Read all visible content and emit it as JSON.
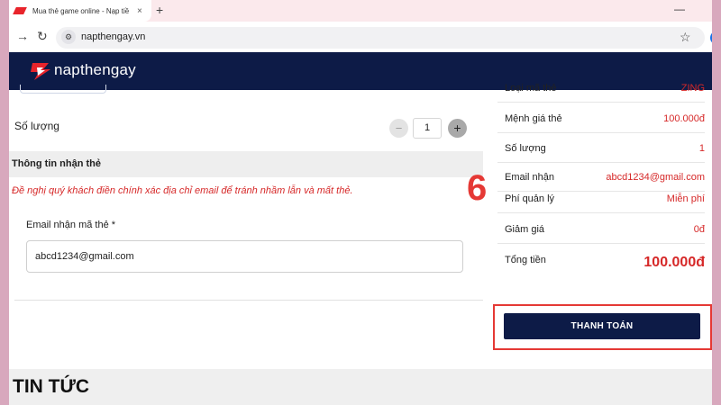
{
  "browser": {
    "tab_title": "Mua thẻ game online - Nạp tiề",
    "tab_close": "×",
    "new_tab": "+",
    "minimize": "—",
    "back": "→",
    "reload": "↻",
    "tune": "⚙",
    "url": "napthengay.vn",
    "bookmark": "☆"
  },
  "site": {
    "logo_text": "napthengay"
  },
  "quantity": {
    "label": "Số lượng",
    "minus": "−",
    "value": "1",
    "plus": "+"
  },
  "card_info": {
    "section_title": "Thông tin nhận thẻ",
    "warning": "Đề nghị quý khách điền chính xác địa chỉ email để tránh nhầm lẫn và mất thẻ.",
    "email_label": "Email nhận mã thẻ *",
    "email_value": "abcd1234@gmail.com"
  },
  "annotation": {
    "step_number": "6"
  },
  "summary": {
    "rows": [
      {
        "label": "Loại mã thẻ",
        "value": "ZING"
      },
      {
        "label": "Mệnh giá thẻ",
        "value": "100.000đ"
      },
      {
        "label": "Số lượng",
        "value": "1"
      },
      {
        "label": "Email nhận",
        "value": "abcd1234@gmail.com"
      },
      {
        "label": "Phí quản lý",
        "value": "Miễn phí"
      },
      {
        "label": "Giảm giá",
        "value": "0đ"
      },
      {
        "label": "Tổng tiền",
        "value": "100.000đ"
      }
    ],
    "pay_button": "THANH TOÁN"
  },
  "news": {
    "title": "TIN TỨC"
  },
  "colors": {
    "brand_navy": "#0d1b47",
    "accent_red": "#d62828",
    "frame_pink": "#d8a8bd"
  }
}
